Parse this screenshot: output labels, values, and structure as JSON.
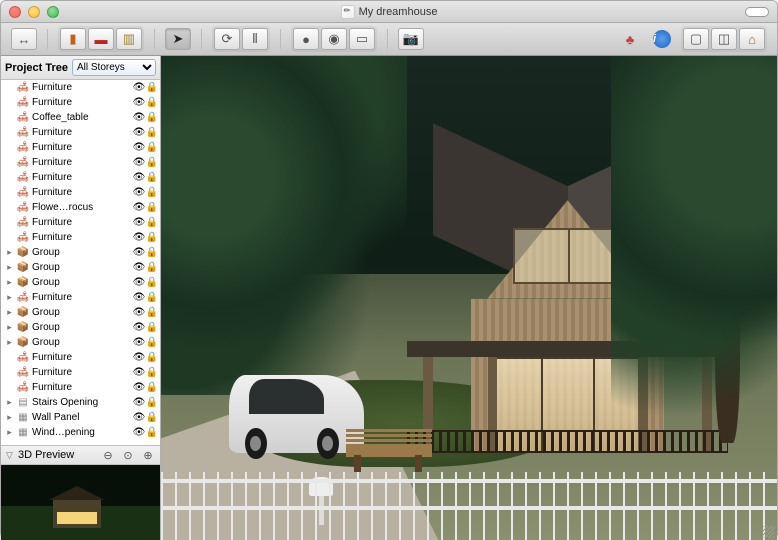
{
  "window": {
    "title": "My dreamhouse"
  },
  "sidebar": {
    "panel_label": "Project Tree",
    "storey_selector": {
      "selected": "All Storeys"
    },
    "items": [
      {
        "label": "Furniture",
        "icon": "furniture",
        "expandable": false
      },
      {
        "label": "Furniture",
        "icon": "furniture",
        "expandable": false
      },
      {
        "label": "Coffee_table",
        "icon": "furniture",
        "expandable": false
      },
      {
        "label": "Furniture",
        "icon": "furniture",
        "expandable": false
      },
      {
        "label": "Furniture",
        "icon": "furniture",
        "expandable": false
      },
      {
        "label": "Furniture",
        "icon": "furniture",
        "expandable": false
      },
      {
        "label": "Furniture",
        "icon": "furniture",
        "expandable": false
      },
      {
        "label": "Furniture",
        "icon": "furniture",
        "expandable": false
      },
      {
        "label": "Flowe…rocus",
        "icon": "furniture",
        "expandable": false
      },
      {
        "label": "Furniture",
        "icon": "furniture",
        "expandable": false
      },
      {
        "label": "Furniture",
        "icon": "furniture",
        "expandable": false
      },
      {
        "label": "Group",
        "icon": "group",
        "expandable": true
      },
      {
        "label": "Group",
        "icon": "group",
        "expandable": true
      },
      {
        "label": "Group",
        "icon": "group",
        "expandable": true
      },
      {
        "label": "Furniture",
        "icon": "furniture",
        "expandable": true
      },
      {
        "label": "Group",
        "icon": "group",
        "expandable": true
      },
      {
        "label": "Group",
        "icon": "group",
        "expandable": true
      },
      {
        "label": "Group",
        "icon": "group",
        "expandable": true
      },
      {
        "label": "Furniture",
        "icon": "furniture",
        "expandable": false
      },
      {
        "label": "Furniture",
        "icon": "furniture",
        "expandable": false
      },
      {
        "label": "Furniture",
        "icon": "furniture",
        "expandable": false
      },
      {
        "label": "Stairs Opening",
        "icon": "stairs",
        "expandable": true
      },
      {
        "label": "Wall Panel",
        "icon": "wall",
        "expandable": true
      },
      {
        "label": "Wind…pening",
        "icon": "wall",
        "expandable": true
      }
    ],
    "preview_label": "3D Preview"
  },
  "toolbar": {
    "groups": {
      "nav": [
        "back-forward"
      ],
      "view": [
        "library-icon",
        "furniture-icon",
        "materials-icon"
      ],
      "select": [
        "cursor-icon"
      ],
      "transform": [
        "rotate-icon",
        "distribute-icon"
      ],
      "render": [
        "record-icon",
        "preview-icon",
        "camera-path-icon"
      ],
      "snapshot": [
        "camera-icon"
      ],
      "right": [
        "share-icon",
        "info-icon",
        "layout-2d-icon",
        "layout-split-icon",
        "layout-3d-icon"
      ]
    }
  }
}
